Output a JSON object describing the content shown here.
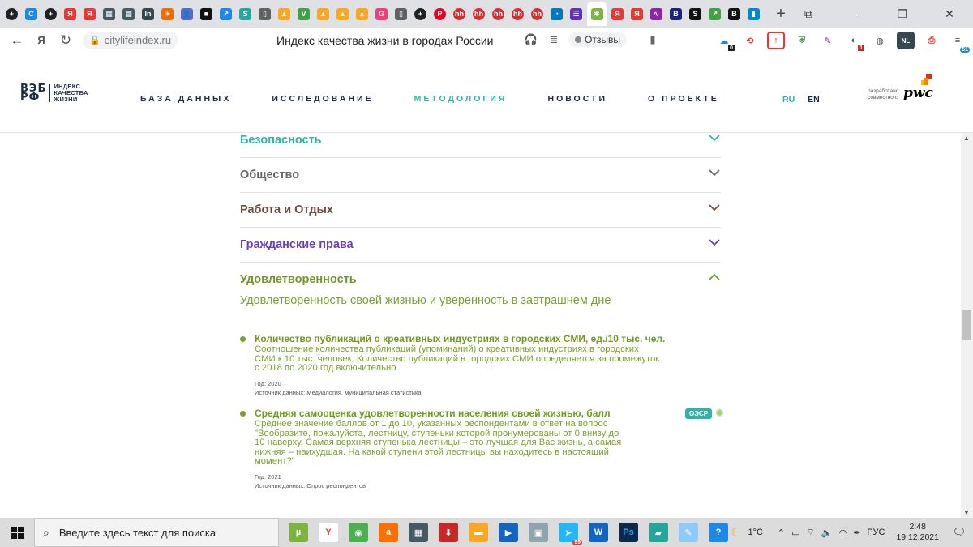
{
  "browser": {
    "tab_favicons": [
      {
        "icon": "generic-plus-icon",
        "color": "#222222",
        "glyph": "+"
      },
      {
        "icon": "c-icon",
        "color": "#1e88e5",
        "glyph": "C"
      },
      {
        "icon": "generic-plus-icon",
        "color": "#222222",
        "glyph": "+"
      },
      {
        "icon": "yandex-icon",
        "color": "#e53935",
        "glyph": "Я"
      },
      {
        "icon": "yandex-icon",
        "color": "#e53935",
        "glyph": "Я"
      },
      {
        "icon": "grid-icon",
        "color": "#455a64",
        "glyph": "▦"
      },
      {
        "icon": "grid-icon",
        "color": "#455a64",
        "glyph": "▦"
      },
      {
        "icon": "in-icon",
        "color": "#37474f",
        "glyph": "In"
      },
      {
        "icon": "sunrise-icon",
        "color": "#ef6c00",
        "glyph": "☀"
      },
      {
        "icon": "user-icon",
        "color": "#5c6bc0",
        "glyph": "👤"
      },
      {
        "icon": "square-icon",
        "color": "#111111",
        "glyph": "■"
      },
      {
        "icon": "arrow-icon",
        "color": "#1e88e5",
        "glyph": "↗"
      },
      {
        "icon": "s-icon",
        "color": "#26a69a",
        "glyph": "S"
      },
      {
        "icon": "document-icon",
        "color": "#616161",
        "glyph": "▯"
      },
      {
        "icon": "landscape-icon",
        "color": "#f9a825",
        "glyph": "▲"
      },
      {
        "icon": "v-icon",
        "color": "#43a047",
        "glyph": "V"
      },
      {
        "icon": "landscape-icon",
        "color": "#f9a825",
        "glyph": "▲"
      },
      {
        "icon": "landscape-icon",
        "color": "#f9a825",
        "glyph": "▲"
      },
      {
        "icon": "landscape-icon",
        "color": "#f9a825",
        "glyph": "▲"
      },
      {
        "icon": "g-icon",
        "color": "#ec407a",
        "glyph": "G"
      },
      {
        "icon": "document-icon",
        "color": "#616161",
        "glyph": "▯"
      },
      {
        "icon": "generic-plus-icon",
        "color": "#222222",
        "glyph": "+"
      },
      {
        "icon": "pinterest-icon",
        "color": "#e60023",
        "glyph": "P"
      },
      {
        "icon": "hh-icon",
        "color": "#d32f2f",
        "glyph": "hh"
      },
      {
        "icon": "hh-icon",
        "color": "#d32f2f",
        "glyph": "hh"
      },
      {
        "icon": "hh-icon",
        "color": "#d32f2f",
        "glyph": "hh"
      },
      {
        "icon": "hh-icon",
        "color": "#d32f2f",
        "glyph": "hh"
      },
      {
        "icon": "hh-icon",
        "color": "#d32f2f",
        "glyph": "hh"
      },
      {
        "icon": "swoosh-icon",
        "color": "#0277bd",
        "glyph": "◔"
      },
      {
        "icon": "list-icon",
        "color": "#5e35b1",
        "glyph": "☰"
      },
      {
        "icon": "star-icon",
        "color": "#7cb342",
        "glyph": "✱",
        "active": true
      },
      {
        "icon": "yandex-icon",
        "color": "#e53935",
        "glyph": "Я"
      },
      {
        "icon": "yandex-icon",
        "color": "#e53935",
        "glyph": "Я"
      },
      {
        "icon": "wave-icon",
        "color": "#8e24aa",
        "glyph": "∿"
      },
      {
        "icon": "b-icon",
        "color": "#1a237e",
        "glyph": "B"
      },
      {
        "icon": "s-icon",
        "color": "#111111",
        "glyph": "S"
      },
      {
        "icon": "arrow-icon",
        "color": "#43a047",
        "glyph": "↗"
      },
      {
        "icon": "b-icon",
        "color": "#111111",
        "glyph": "B"
      },
      {
        "icon": "book-icon",
        "color": "#0288d1",
        "glyph": "▮"
      }
    ],
    "address": {
      "url": "citylifeindex.ru",
      "page_title": "Индекс качества жизни в городах России",
      "reviews_label": "Отзывы"
    },
    "extension_badges": [
      "0",
      "1",
      "NL",
      "51"
    ]
  },
  "site": {
    "logo": {
      "mark_line1": "ВЭБ",
      "mark_line2": "РФ",
      "text_line1": "ИНДЕКС",
      "text_line2": "КАЧЕСТВА",
      "text_line3": "ЖИЗНИ"
    },
    "nav": [
      {
        "label": "БАЗА ДАННЫХ",
        "active": false
      },
      {
        "label": "ИССЛЕДОВАНИЕ",
        "active": false
      },
      {
        "label": "МЕТОДОЛОГИЯ",
        "active": true
      },
      {
        "label": "НОВОСТИ",
        "active": false
      },
      {
        "label": "О ПРОЕКТЕ",
        "active": false
      }
    ],
    "lang": {
      "ru": "RU",
      "en": "EN"
    },
    "partner": {
      "caption_line1": "разработано",
      "caption_line2": "совместно с",
      "brand": "pwc"
    }
  },
  "accordion": [
    {
      "title": "Безопасность",
      "color": "#2fb3a5",
      "open": false
    },
    {
      "title": "Общество",
      "color": "#666666",
      "open": false
    },
    {
      "title": "Работа и Отдых",
      "color": "#6d4c41",
      "open": false
    },
    {
      "title": "Гражданские права",
      "color": "#6a3fb1",
      "open": false
    },
    {
      "title": "Удовлетворенность",
      "color": "#6f9a22",
      "open": true
    }
  ],
  "open_section": {
    "description": "Удовлетворенность своей жизнью и уверенность в завтрашнем дне",
    "indicators": [
      {
        "title": "Количество публикаций о креативных индустриях в городских СМИ, ед./10 тыс. чел.",
        "desc_lines": [
          "Соотношение количества публикаций (упоминаний) о креативных индустриях в городских",
          "СМИ к 10 тыс. человек. Количество публикаций в городских СМИ определяется за промежуток",
          "с 2018 по 2020 год включительно"
        ],
        "year": "Год: 2020",
        "source": "Источник данных: Медиалогия, муниципальная статистика"
      },
      {
        "title": "Средняя самооценка удовлетворенности населения своей жизнью, балл",
        "desc_lines": [
          "Среднее значение баллов от 1 до 10, указанных респондентами в ответ на вопрос",
          "\"Вообразите, пожалуйста, лестницу, ступеньки которой пронумерованы от 0 внизу до",
          "10 наверху. Самая верхняя ступенька лестницы – это лучшая для Вас жизнь, а самая",
          "нижняя – наихудшая. На какой ступени этой лестницы вы находитесь в настоящий",
          "момент?\""
        ],
        "year": "Год: 2021",
        "source": "Источник данных: Опрос респондентов",
        "badge": "ОЭСР"
      }
    ]
  },
  "taskbar": {
    "search_placeholder": "Введите здесь текст для поиска",
    "apps": [
      {
        "icon": "utorrent-icon",
        "color": "#7cb342",
        "glyph": "µ"
      },
      {
        "icon": "yandex-browser-icon",
        "color": "#ffffff",
        "glyph": "Y",
        "fg": "#e53935"
      },
      {
        "icon": "chrome-icon",
        "color": "#4caf50",
        "glyph": "◉"
      },
      {
        "icon": "avast-icon",
        "color": "#ff6f00",
        "glyph": "a"
      },
      {
        "icon": "calculator-icon",
        "color": "#455a64",
        "glyph": "▦"
      },
      {
        "icon": "download-icon",
        "color": "#c62828",
        "glyph": "⬇"
      },
      {
        "icon": "folder-icon",
        "color": "#f9a825",
        "glyph": "▬"
      },
      {
        "icon": "media-player-icon",
        "color": "#1565c0",
        "glyph": "▶"
      },
      {
        "icon": "photos-icon",
        "color": "#90a4ae",
        "glyph": "▣"
      },
      {
        "icon": "telegram-icon",
        "color": "#29b6f6",
        "glyph": "➤",
        "badge": "99"
      },
      {
        "icon": "word-icon",
        "color": "#1565c0",
        "glyph": "W"
      },
      {
        "icon": "photoshop-icon",
        "color": "#0d2a4a",
        "glyph": "Ps",
        "fg": "#31a8ff"
      },
      {
        "icon": "notebook-icon",
        "color": "#26a69a",
        "glyph": "▰"
      },
      {
        "icon": "paint-icon",
        "color": "#90caf9",
        "glyph": "✎"
      },
      {
        "icon": "help-icon",
        "color": "#1e88e5",
        "glyph": "?"
      }
    ],
    "weather": "1°C",
    "lang": "РУС",
    "time": "2:48",
    "date": "19.12.2021"
  }
}
